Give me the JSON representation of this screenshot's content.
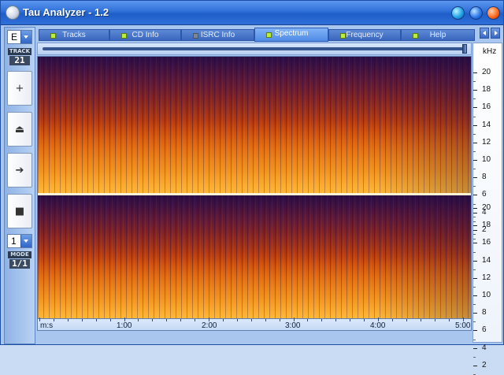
{
  "window": {
    "title": "Tau Analyzer - 1.2"
  },
  "left_panel": {
    "drive_select": "E",
    "track_label": "TRACK",
    "track_number": "21",
    "buttons": [
      {
        "name": "add",
        "glyph": "+"
      },
      {
        "name": "eject",
        "glyph": "⏏"
      },
      {
        "name": "play",
        "glyph": "➔"
      },
      {
        "name": "stop",
        "glyph": "■"
      }
    ],
    "mode_select": "1",
    "mode_label": "MODE",
    "mode_value": "1/1"
  },
  "tabs": [
    {
      "label": "Tracks",
      "active": false
    },
    {
      "label": "CD Info",
      "active": false
    },
    {
      "label": "ISRC Info",
      "active": false
    },
    {
      "label": "Spectrum",
      "active": true
    },
    {
      "label": "Frequency",
      "active": false
    },
    {
      "label": "Help",
      "active": false
    }
  ],
  "spectrum": {
    "frequency_unit": "kHz",
    "frequency_labels": [
      "20",
      "18",
      "16",
      "14",
      "12",
      "10",
      "8",
      "6",
      "4",
      "2"
    ],
    "time_unit_label": "m:s",
    "time_labels": [
      "1:00",
      "2:00",
      "3:00",
      "4:00",
      "5:00"
    ],
    "channels": [
      "top",
      "bottom"
    ]
  },
  "colors": {
    "titlebar": "#2f6fd8",
    "active_tab": "#4f8be6",
    "spectrum_low": "#ffb230",
    "spectrum_high": "#3a1350"
  }
}
